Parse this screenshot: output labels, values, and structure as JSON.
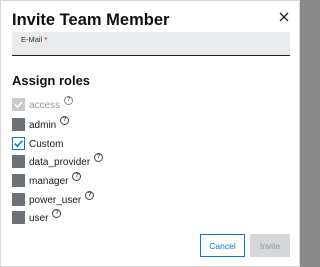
{
  "dialog": {
    "title": "Invite Team Member",
    "close_icon": "close-icon"
  },
  "email": {
    "label": "E-Mail",
    "required_marker": "*",
    "value": ""
  },
  "roles_section": {
    "heading": "Assign roles",
    "help_symbol": "?",
    "items": [
      {
        "label": "access",
        "checked": true,
        "disabled": true
      },
      {
        "label": "admin",
        "checked": false,
        "disabled": false
      },
      {
        "label": "Custom",
        "checked": true,
        "disabled": false
      },
      {
        "label": "data_provider",
        "checked": false,
        "disabled": false
      },
      {
        "label": "manager",
        "checked": false,
        "disabled": false
      },
      {
        "label": "power_user",
        "checked": false,
        "disabled": false
      },
      {
        "label": "user",
        "checked": false,
        "disabled": false
      }
    ]
  },
  "actions": {
    "cancel_label": "Cancel",
    "invite_label": "Invite",
    "invite_disabled": true
  },
  "colors": {
    "accent": "#0a78c8",
    "checkbox_unchecked": "#6d7277",
    "checkbox_disabled": "#c8cacd",
    "field_background": "#e9eaec"
  }
}
